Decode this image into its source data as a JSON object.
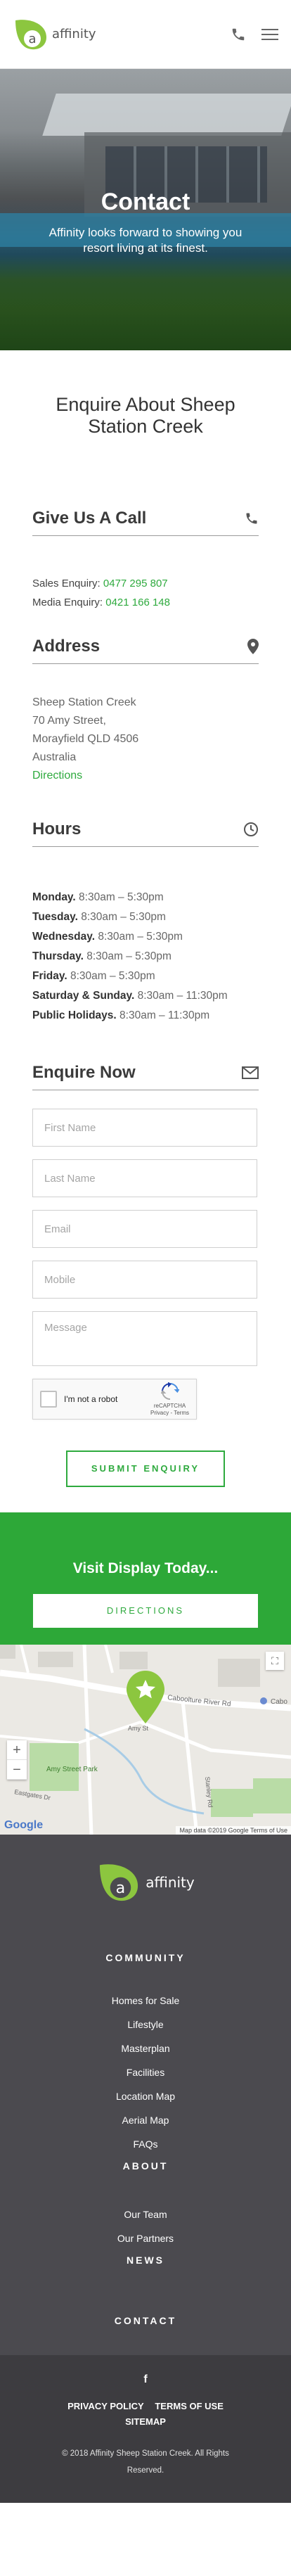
{
  "header": {
    "brand": "affinity",
    "icons": [
      "phone-icon",
      "hamburger-menu-icon"
    ]
  },
  "hero": {
    "title": "Contact",
    "subtitle": "Affinity looks forward to showing you resort living at its finest."
  },
  "enquire_about": {
    "heading": "Enquire About Sheep Station Creek"
  },
  "call": {
    "heading": "Give Us A Call",
    "sales_label": "Sales Enquiry:",
    "sales_phone": "0477 295 807",
    "media_label": "Media Enquiry:",
    "media_phone": "0421 166 148"
  },
  "address": {
    "heading": "Address",
    "line1": "Sheep Station Creek",
    "line2": "70 Amy Street,",
    "line3": "Morayfield QLD 4506",
    "line4": "Australia",
    "directions": "Directions"
  },
  "hours": {
    "heading": "Hours",
    "rows": [
      {
        "day": "Monday.",
        "time": "8:30am – 5:30pm"
      },
      {
        "day": "Tuesday.",
        "time": "8:30am – 5:30pm"
      },
      {
        "day": "Wednesday.",
        "time": "8:30am – 5:30pm"
      },
      {
        "day": "Thursday.",
        "time": "8:30am – 5:30pm"
      },
      {
        "day": "Friday.",
        "time": "8:30am – 5:30pm"
      },
      {
        "day": "Saturday & Sunday.",
        "time": "8:30am – 11:30pm"
      },
      {
        "day": "Public Holidays.",
        "time": "8:30am – 11:30pm"
      }
    ]
  },
  "enquire": {
    "heading": "Enquire Now",
    "first_name": "First Name",
    "last_name": "Last Name",
    "email": "Email",
    "mobile": "Mobile",
    "message": "Message",
    "captcha_label": "I'm not a robot",
    "captcha_brand": "reCAPTCHA",
    "captcha_terms": "Privacy - Terms",
    "submit": "SUBMIT ENQUIRY"
  },
  "visit": {
    "heading": "Visit Display Today...",
    "button": "DIRECTIONS"
  },
  "map": {
    "road1": "Caboolture River Rd",
    "road2": "Amy St",
    "road3": "Stanley Rd",
    "road4": "Cabo",
    "park": "Amy Street Park",
    "street": "Eastgates Dr",
    "google": "Google",
    "attribution": "Map data ©2019 Google   Terms of Use",
    "zoom_in": "+",
    "zoom_out": "−"
  },
  "footer": {
    "brand": "affinity",
    "community": "COMMUNITY",
    "community_items": [
      "Homes for Sale",
      "Lifestyle",
      "Masterplan",
      "Facilities",
      "Location Map",
      "Aerial Map",
      "FAQs"
    ],
    "about": "ABOUT",
    "about_items": [
      "Our Team",
      "Our Partners"
    ],
    "news": "NEWS",
    "contact": "CONTACT",
    "facebook": "f",
    "privacy": "PRIVACY POLICY",
    "terms": "TERMS OF USE",
    "sitemap": "SITEMAP",
    "copyright": "© 2018 Affinity Sheep Station Creek. All Rights Reserved."
  },
  "colors": {
    "accent_green": "#2eaa3e",
    "footer_bg": "#4b4a4f"
  }
}
